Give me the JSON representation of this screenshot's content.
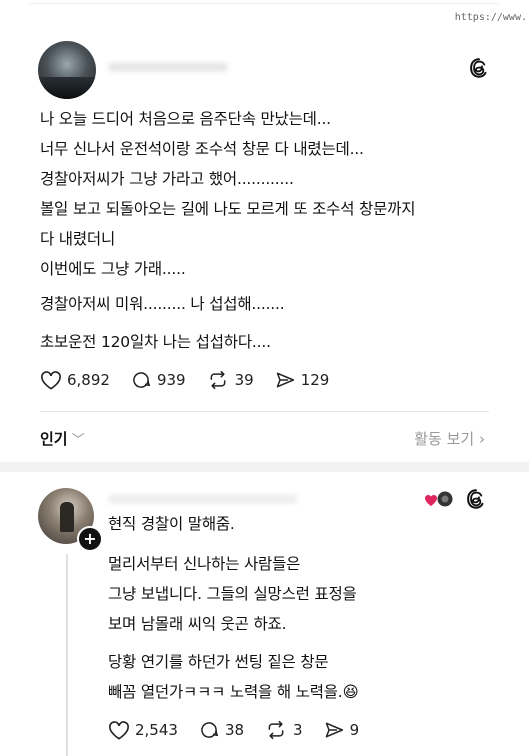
{
  "url_fragment": "https://www.",
  "post": {
    "lines_group1": [
      "나 오늘 드디어 처음으로 음주단속 만났는데...",
      "너무 신나서 운전석이랑 조수석 창문 다 내렸는데...",
      "경찰아저씨가 그냥 가라고 했어............",
      "볼일 보고 되돌아오는 길에 나도 모르게 또 조수석 창문까지",
      "다 내렸더니",
      "이번에도 그냥 가래....."
    ],
    "line_group2": "경찰아저씨 미워......... 나 섭섭해.......",
    "line_group3": "초보운전 120일차 나는 섭섭하다....",
    "likes": "6,892",
    "comments": "939",
    "reposts": "39",
    "shares": "129"
  },
  "tabs": {
    "popular": "인기",
    "activity": "활동 보기"
  },
  "reply": {
    "line1": "현직 경찰이 말해줌.",
    "para2": [
      "멀리서부터 신나하는 사람들은",
      "그냥 보냅니다. 그들의 실망스런 표정을",
      "보며 남몰래 씨익 웃곤 하죠."
    ],
    "para3": [
      "당황 연기를 하던가 썬팅 짙은 창문",
      "빼꼼 열던가ㅋㅋㅋ 노력을 해 노력을."
    ],
    "emoji": "😆",
    "likes": "2,543",
    "comments": "38",
    "reposts": "3",
    "shares": "9"
  },
  "icons": [
    "threads-logo-icon",
    "heart-icon",
    "comment-icon",
    "repost-icon",
    "share-icon",
    "chevron-down-icon",
    "chevron-right-icon",
    "plus-icon"
  ],
  "colors": {
    "text": "#111111",
    "muted": "#999999",
    "like_heart": "#e0245e"
  }
}
